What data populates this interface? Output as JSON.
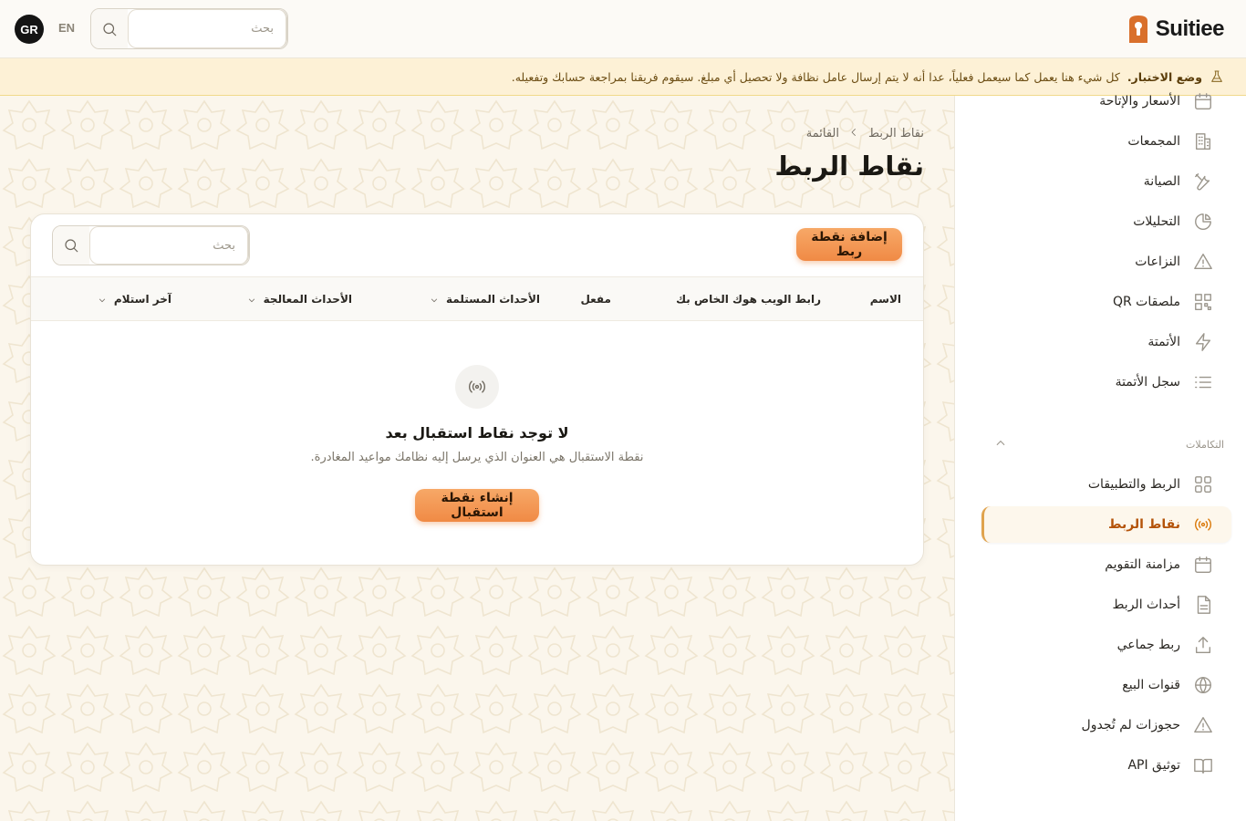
{
  "app": {
    "brand": "Suitiee",
    "avatar_initials": "GR",
    "language": "EN"
  },
  "top_search": {
    "placeholder": "بحث"
  },
  "banner": {
    "title": "وضع الاختبار.",
    "message": "كل شيء هنا يعمل كما سيعمل فعلياً، عدا أنه لا يتم إرسال عامل نظافة ولا تحصيل أي مبلغ. سيقوم فريقنا بمراجعة حسابك وتفعيله."
  },
  "sidebar": {
    "items_top": [
      {
        "label": "الأسعار والإتاحة",
        "icon": "calendar-icon"
      },
      {
        "label": "المجمعات",
        "icon": "building-icon"
      },
      {
        "label": "الصيانة",
        "icon": "tools-icon"
      },
      {
        "label": "التحليلات",
        "icon": "pie-chart-icon"
      },
      {
        "label": "النزاعات",
        "icon": "warning-icon"
      },
      {
        "label": "ملصقات QR",
        "icon": "qr-icon"
      },
      {
        "label": "الأتمتة",
        "icon": "bolt-icon"
      },
      {
        "label": "سجل الأتمتة",
        "icon": "list-icon"
      }
    ],
    "section_label": "التكاملات",
    "items_integrations": [
      {
        "label": "الربط والتطبيقات",
        "icon": "grid-icon"
      },
      {
        "label": "نقاط الربط",
        "icon": "broadcast-icon",
        "active": true
      },
      {
        "label": "مزامنة التقويم",
        "icon": "calendar-icon"
      },
      {
        "label": "أحداث الربط",
        "icon": "file-icon"
      },
      {
        "label": "ربط جماعي",
        "icon": "upload-icon"
      },
      {
        "label": "قنوات البيع",
        "icon": "globe-icon"
      },
      {
        "label": "حجوزات لم تُجدول",
        "icon": "warning-icon"
      },
      {
        "label": "توثيق API",
        "icon": "book-icon"
      }
    ]
  },
  "page": {
    "breadcrumb": [
      "نقاط الربط",
      "القائمة"
    ],
    "title": "نقاط الربط",
    "add_button": "إضافة نقطة ربط",
    "search_placeholder": "بحث",
    "columns": [
      "الاسم",
      "رابط الويب هوك الخاص بك",
      "مفعل",
      "الأحداث المستلمة",
      "الأحداث المعالجة",
      "آخر استلام"
    ],
    "empty": {
      "title": "لا توجد نقاط استقبال بعد",
      "description": "نقطة الاستقبال هي العنوان الذي يرسل إليه نظامك مواعيد المغادرة.",
      "button": "إنشاء نقطة استقبال"
    }
  },
  "colors": {
    "accent": "#f08a45",
    "active_text": "#b45309",
    "banner_bg": "#fdf1d6"
  }
}
